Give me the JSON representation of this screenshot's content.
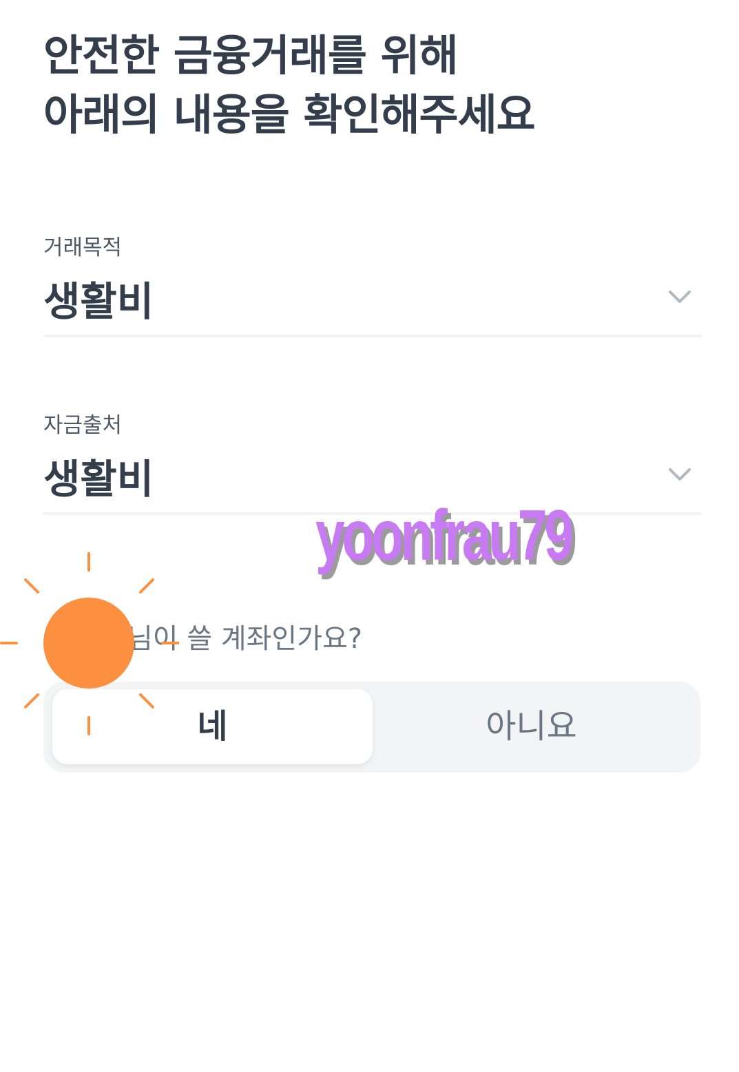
{
  "header": {
    "title_line1": "안전한 금융거래를 위해",
    "title_line2": "아래의 내용을 확인해주세요"
  },
  "fields": [
    {
      "label": "거래목적",
      "value": "생활비",
      "icon": "chevron-down-icon"
    },
    {
      "label": "자금출처",
      "value": "생활비",
      "icon": "chevron-down-icon"
    }
  ],
  "question": {
    "text": "님이 쓸 계좌인가요?"
  },
  "segmented": {
    "options": [
      "네",
      "아니요"
    ],
    "selected": "네"
  },
  "overlay": {
    "sticker": "sun-sticker",
    "sticker_color": "#fc8f40",
    "watermark_text": "yoonfrau79",
    "watermark_color": "#c77af2"
  },
  "colors": {
    "text_primary": "#333d4b",
    "text_secondary": "#6b7684",
    "chevron": "#b0b8c1",
    "divider": "#f2f4f6",
    "segment_bg": "#f2f4f6"
  }
}
